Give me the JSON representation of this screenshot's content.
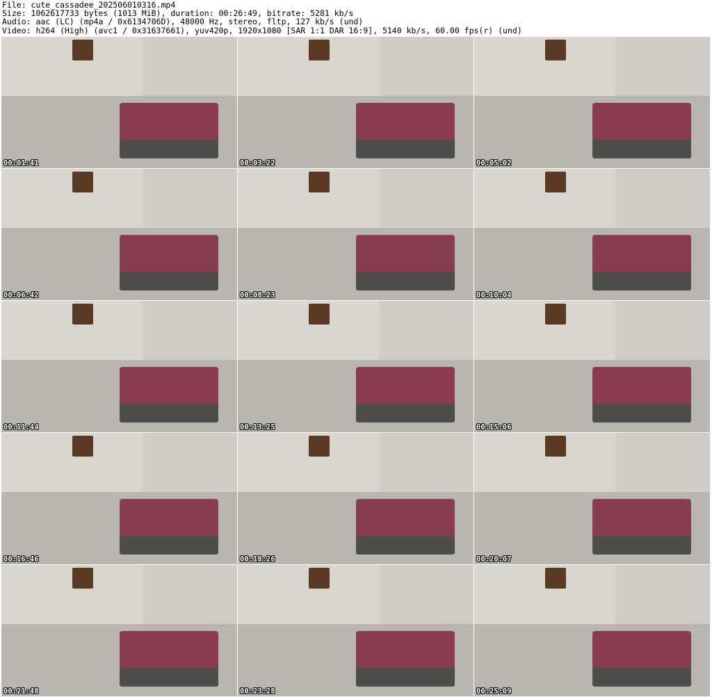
{
  "header": {
    "line1": "File: cute_cassadee_202506010316.mp4",
    "line2": "Size: 1062617733 bytes (1013 MiB), duration: 00:26:49, bitrate: 5281 kb/s",
    "line3": "Audio: aac (LC) (mp4a / 0x6134706D), 48000 Hz, stereo, fltp, 127 kb/s (und)",
    "line4": "Video: h264 (High) (avc1 / 0x31637661), yuv420p, 1920x1080 [SAR 1:1 DAR 16:9], 5140 kb/s, 60.00 fps(r) (und)"
  },
  "thumbnails": [
    {
      "timestamp": "00:01:41"
    },
    {
      "timestamp": "00:03:22"
    },
    {
      "timestamp": "00:05:02"
    },
    {
      "timestamp": "00:06:42"
    },
    {
      "timestamp": "00:08:23"
    },
    {
      "timestamp": "00:10:04"
    },
    {
      "timestamp": "00:11:44"
    },
    {
      "timestamp": "00:13:25"
    },
    {
      "timestamp": "00:15:06"
    },
    {
      "timestamp": "00:16:46"
    },
    {
      "timestamp": "00:18:26"
    },
    {
      "timestamp": "00:20:07"
    },
    {
      "timestamp": "00:21:48"
    },
    {
      "timestamp": "00:23:28"
    },
    {
      "timestamp": "00:25:09"
    }
  ]
}
